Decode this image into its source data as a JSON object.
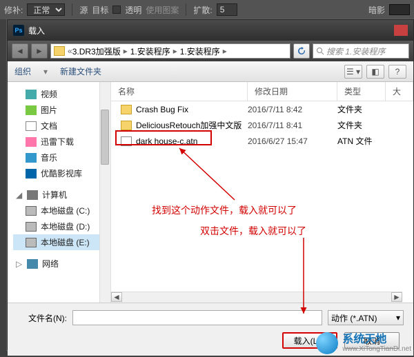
{
  "toolbar": {
    "label1": "修补:",
    "mode": "正常",
    "src": "源",
    "dst": "目标",
    "transparent": "透明",
    "use_pattern": "使用图案",
    "diffusion_label": "扩散:",
    "diffusion_value": "5",
    "shadow": "暗影"
  },
  "dialog": {
    "title": "载入",
    "breadcrumb": [
      "3.DR3加强版",
      "1.安装程序",
      "1.安装程序"
    ],
    "search_placeholder": "搜索 1.安装程序",
    "organize": "组织",
    "new_folder": "新建文件夹",
    "columns": {
      "name": "名称",
      "date": "修改日期",
      "type": "类型",
      "size": "大"
    },
    "files": [
      {
        "name": "Crash Bug Fix",
        "date": "2016/7/11 8:42",
        "type": "文件夹",
        "icon": "folder"
      },
      {
        "name": "DeliciousRetouch加强中文版",
        "date": "2016/7/11 8:41",
        "type": "文件夹",
        "icon": "folder"
      },
      {
        "name": "dark house-c.atn",
        "date": "2016/6/27 15:47",
        "type": "ATN 文件",
        "icon": "file"
      }
    ],
    "filename_label": "文件名(N):",
    "filter": "动作 (*.ATN)",
    "load_btn": "载入(L)",
    "cancel_btn": "取消"
  },
  "sidebar": {
    "items": [
      {
        "label": "视频",
        "icon": "ico-video"
      },
      {
        "label": "图片",
        "icon": "ico-pic"
      },
      {
        "label": "文档",
        "icon": "ico-doc"
      },
      {
        "label": "迅雷下载",
        "icon": "ico-dl"
      },
      {
        "label": "音乐",
        "icon": "ico-music"
      },
      {
        "label": "优酷影视库",
        "icon": "ico-youku"
      }
    ],
    "computer": "计算机",
    "drives": [
      {
        "label": "本地磁盘 (C:)"
      },
      {
        "label": "本地磁盘 (D:)"
      },
      {
        "label": "本地磁盘 (E:)"
      }
    ],
    "network": "网络"
  },
  "annotations": {
    "line1": "找到这个动作文件，载入就可以了",
    "line2": "双击文件，载入就可以了"
  },
  "watermark": {
    "title": "系统天地",
    "sub": "www.XiTongTianDi.net"
  }
}
